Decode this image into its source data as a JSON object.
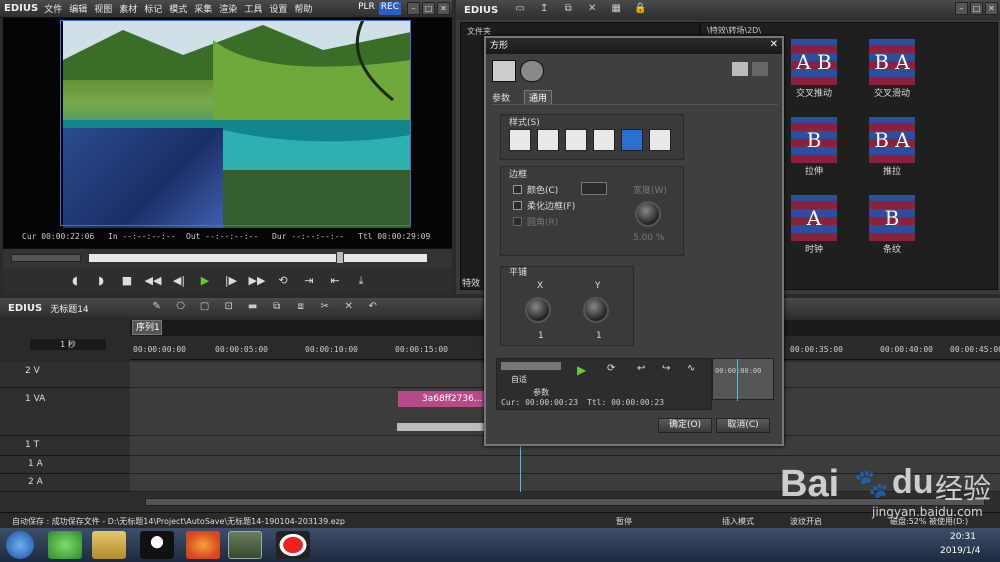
{
  "player": {
    "logo": "EDIUS",
    "menus": [
      "文件",
      "编辑",
      "视图",
      "素材",
      "标记",
      "模式",
      "采集",
      "渲染",
      "工具",
      "设置",
      "帮助"
    ],
    "plr": "PLR",
    "rec": "REC",
    "cur_label": "Cur",
    "cur": "00:00:22:06",
    "in_label": "In",
    "in": "--:--:--:--",
    "out_label": "Out",
    "out": "--:--:--:--",
    "dur_label": "Dur",
    "dur": "--:--:--:--",
    "ttl_label": "Ttl",
    "ttl": "00:00:29:09"
  },
  "bin": {
    "logo": "EDIUS",
    "folder_label": "文件夹",
    "path": "\\特效\\转场\\2D\\",
    "tab": "特效",
    "effects": [
      {
        "label": "交叉推动",
        "glyph": "A B"
      },
      {
        "label": "交叉滑动",
        "glyph": "B A"
      },
      {
        "label": "拉伸",
        "glyph": "B"
      },
      {
        "label": "推拉",
        "glyph": "B A"
      },
      {
        "label": "时钟",
        "glyph": "A"
      },
      {
        "label": "条纹",
        "glyph": "B"
      }
    ]
  },
  "timeline": {
    "logo": "EDIUS",
    "project": "无标题14",
    "sequence_tab": "序列1",
    "scale": "1 秒",
    "ruler": [
      "00:00:00:00",
      "00:00:05:00",
      "00:00:10:00",
      "00:00:15:00",
      "00:00:35:00",
      "00:00:40:00",
      "00:00:45:00"
    ],
    "tracks": [
      "2 V",
      "1 VA",
      "1 T",
      "1 A",
      "2 A"
    ],
    "clip": "3a68ff2736..."
  },
  "dialog": {
    "title": "方形",
    "tabs": [
      "参数",
      "通用"
    ],
    "style_label": "样式(S)",
    "border_label": "边框",
    "color_label": "颜色(C)",
    "soft_label": "柔化边框(F)",
    "round_label": "圆角(R)",
    "width_label": "宽度(W)",
    "width_value": "5.00 %",
    "tile_label": "平铺",
    "x_label": "X",
    "y_label": "Y",
    "x_value": "1",
    "y_value": "1",
    "auto_label": "自适",
    "param_label": "参数",
    "cur_line": "Cur: 00:00:00:23",
    "ttl_line": "Ttl: 00:00:00:23",
    "mini_ruler": "00:00:00:00",
    "ok": "确定(O)",
    "cancel": "取消(C)"
  },
  "status": {
    "save": "自动保存 : 成功保存文件 - D:\\无标题14\\Project\\AutoSave\\无标题14-190104-203139.ezp",
    "pause": "暂停",
    "insert": "插入模式",
    "ripple": "波纹开启",
    "disk": "磁盘:52% 被使用(D:)"
  },
  "taskbar": {
    "time": "20:31",
    "date": "2019/1/4"
  },
  "watermark": {
    "brand": "Bai",
    "paw": "du",
    "cn": "经验",
    "url": "jingyan.baidu.com"
  }
}
